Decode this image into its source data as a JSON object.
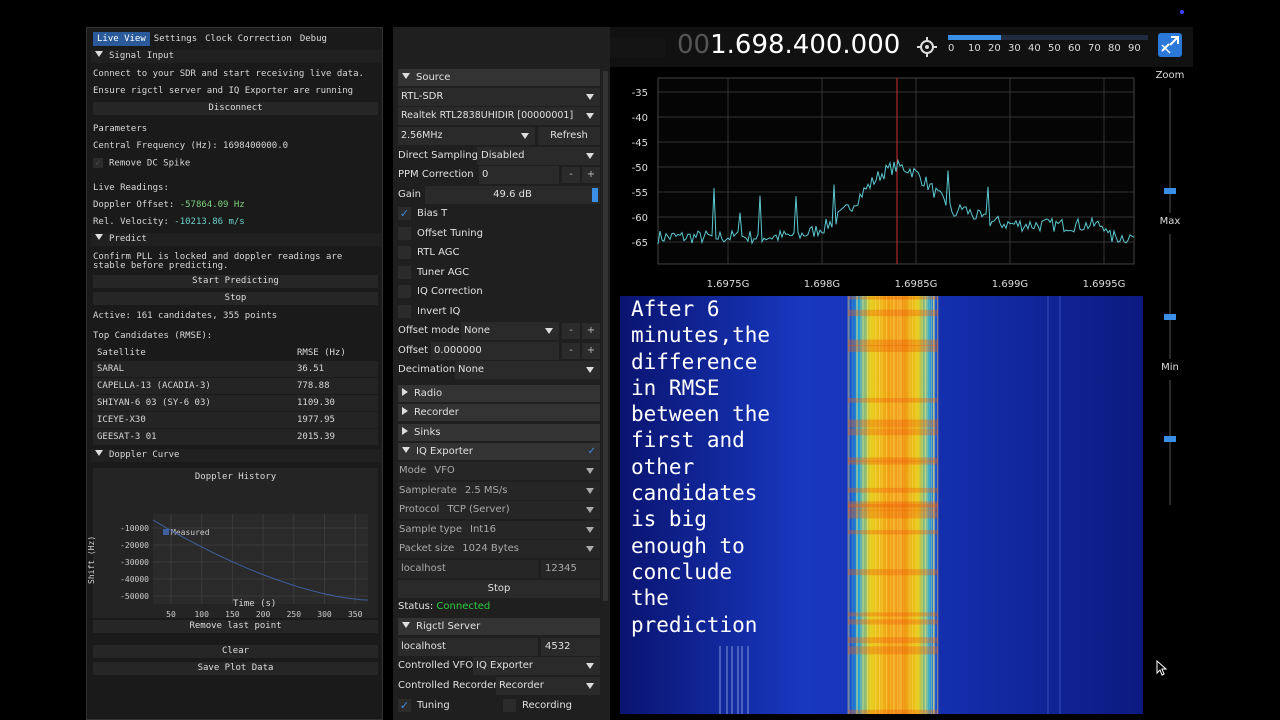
{
  "left_panel": {
    "tabs": [
      "Live View",
      "Settings",
      "Clock Correction",
      "Debug"
    ],
    "signal_input_header": "Signal Input",
    "connect_msg": "Connect to your SDR and start receiving live data.",
    "ensure_msg": "Ensure rigctl server and IQ Exporter are running",
    "disconnect_label": "Disconnect",
    "parameters_label": "Parameters",
    "central_freq": "Central Frequency (Hz): 1698400000.0",
    "remove_dc_label": "Remove DC Spike",
    "live_readings_label": "Live Readings:",
    "doppler_label": "Doppler Offset:",
    "doppler_value": "-57864.09 Hz",
    "velocity_label": "Rel. Velocity:",
    "velocity_value": "-10213.86 m/s",
    "predict_header": "Predict",
    "predict_msg1": "Confirm PLL is locked and doppler readings are",
    "predict_msg2": "stable before predicting.",
    "start_predicting_label": "Start Predicting",
    "stop_label": "Stop",
    "active_text": "Active: 161 candidates, 355 points",
    "top_candidates_label": "Top Candidates (RMSE):",
    "table_headers": [
      "Satellite",
      "RMSE (Hz)"
    ],
    "candidates": [
      {
        "name": "SARAL",
        "rmse": "36.51"
      },
      {
        "name": "CAPELLA-13 (ACADIA-3)",
        "rmse": "778.88"
      },
      {
        "name": "SHIYAN-6 03 (SY-6 03)",
        "rmse": "1109.30"
      },
      {
        "name": "ICEYE-X30",
        "rmse": "1977.95"
      },
      {
        "name": "GEESAT-3 01",
        "rmse": "2015.39"
      }
    ],
    "doppler_curve_header": "Doppler Curve",
    "doppler_chart": {
      "title": "Doppler History",
      "ylabel": "Shift (Hz)",
      "xlabel": "Time (s)",
      "legend": "Measured",
      "yticks": [
        "-10000",
        "-20000",
        "-30000",
        "-40000",
        "-50000"
      ],
      "xticks": [
        "50",
        "100",
        "150",
        "200",
        "250",
        "300",
        "350"
      ],
      "line_color": "#3f5fa0"
    },
    "remove_last_label": "Remove last point",
    "clear_label": "Clear",
    "save_plot_label": "Save Plot Data"
  },
  "topbar": {
    "frequency_dim": "00",
    "frequency_main": "1.698.400.000",
    "snr_ticks": [
      "0",
      "10",
      "20",
      "30",
      "40",
      "50",
      "60",
      "70",
      "80",
      "90"
    ]
  },
  "source": {
    "header": "Source",
    "device": "RTL-SDR",
    "serial": "Realtek RTL2838UHIDIR [00000001]",
    "sample_rate": "2.56MHz",
    "refresh_label": "Refresh",
    "direct_sampling_label": "Direct Sampling",
    "direct_sampling_value": "Disabled",
    "ppm_label": "PPM Correction",
    "ppm_value": "0",
    "gain_label": "Gain",
    "gain_value": "49.6 dB",
    "bias_t": "Bias T",
    "offset_tuning": "Offset Tuning",
    "rtl_agc": "RTL AGC",
    "tuner_agc": "Tuner AGC",
    "iq_correction": "IQ Correction",
    "invert_iq": "Invert IQ",
    "offset_mode_label": "Offset mode",
    "offset_mode_value": "None",
    "offset_label": "Offset",
    "offset_value": "0.000000",
    "decimation_label": "Decimation",
    "decimation_value": "None"
  },
  "modules": {
    "radio": "Radio",
    "recorder": "Recorder",
    "sinks": "Sinks",
    "iq_exporter": "IQ Exporter",
    "mode_label": "Mode",
    "mode_value": "VFO",
    "samplerate_label": "Samplerate",
    "samplerate_value": "2.5 MS/s",
    "protocol_label": "Protocol",
    "protocol_value": "TCP (Server)",
    "sample_type_label": "Sample type",
    "sample_type_value": "Int16",
    "packet_size_label": "Packet size",
    "packet_size_value": "1024 Bytes",
    "host": "localhost",
    "port": "12345",
    "stop_label": "Stop",
    "status_label": "Status:",
    "status_value": "Connected",
    "rigctl_server": "Rigctl Server",
    "rig_host": "localhost",
    "rig_port": "4532",
    "controlled_vfo_label": "Controlled VFO",
    "controlled_vfo_value": "IQ Exporter",
    "controlled_rec_label": "Controlled Recorder",
    "controlled_rec_value": "Recorder",
    "tuning_label": "Tuning",
    "recording_label": "Recording"
  },
  "fft": {
    "yticks": [
      "-35",
      "-40",
      "-45",
      "-50",
      "-55",
      "-60",
      "-65"
    ],
    "xticks": [
      "1.6975G",
      "1.698G",
      "1.6985G",
      "1.699G",
      "1.6995G"
    ],
    "trace_color": "#5cc8d0",
    "marker_color": "#d03030"
  },
  "overlay_text": [
    "After 6",
    "minutes,the",
    "difference",
    "in RMSE",
    "between the",
    "first and",
    "other",
    "candidates",
    "is big",
    "enough to",
    "conclude",
    "the",
    "prediction"
  ],
  "sliders": {
    "zoom_label": "Zoom",
    "max_label": "Max",
    "min_label": "Min"
  },
  "accent": "#3a8ee6"
}
